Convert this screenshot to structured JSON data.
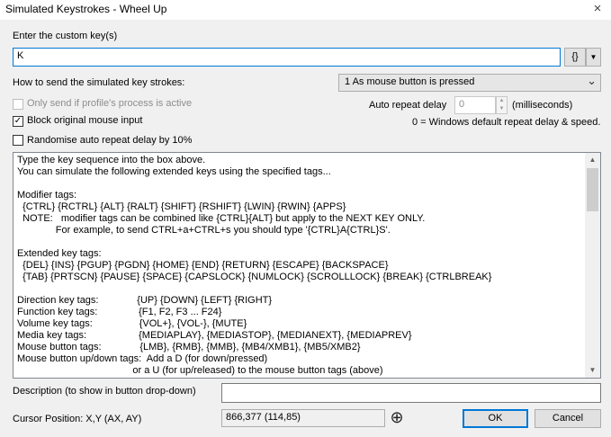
{
  "window": {
    "title": "Simulated Keystrokes - Wheel Up",
    "close_glyph": "×"
  },
  "custom_keys": {
    "label": "Enter the custom key(s)",
    "value": "K",
    "tags_button_label": "{}",
    "tags_dropdown_glyph": "▼"
  },
  "send_mode": {
    "label": "How to send the simulated key strokes:",
    "selected": "1 As mouse button is pressed",
    "arrow_glyph": "⌄"
  },
  "options": {
    "only_send_if_active": {
      "label": "Only send if profile's process is active",
      "checked": false,
      "disabled": true
    },
    "block_original": {
      "label": "Block original mouse input",
      "checked": true
    },
    "randomise_delay": {
      "label": "Randomise auto repeat delay by 10%",
      "checked": false
    }
  },
  "auto_repeat": {
    "label": "Auto repeat delay",
    "value": "0",
    "units": "(milliseconds)",
    "note": "0 = Windows default repeat delay & speed.",
    "up_glyph": "▲",
    "down_glyph": "▼"
  },
  "help_text": [
    "Type the key sequence into the box above.",
    "You can simulate the following extended keys using the specified tags...",
    "",
    "Modifier tags:",
    "  {CTRL} {RCTRL} {ALT} {RALT} {SHIFT} {RSHIFT} {LWIN} {RWIN} {APPS}",
    "  NOTE:   modifier tags can be combined like {CTRL}{ALT} but apply to the NEXT KEY ONLY.",
    "              For example, to send CTRL+a+CTRL+s you should type '{CTRL}A{CTRL}S'.",
    "",
    "Extended key tags:",
    "  {DEL} {INS} {PGUP} {PGDN} {HOME} {END} {RETURN} {ESCAPE} {BACKSPACE}",
    "  {TAB} {PRTSCN} {PAUSE} {SPACE} {CAPSLOCK} {NUMLOCK} {SCROLLLOCK} {BREAK} {CTRLBREAK}",
    "",
    "Direction key tags:              {UP} {DOWN} {LEFT} {RIGHT}",
    "Function key tags:               {F1, F2, F3 ... F24}",
    "Volume key tags:                 {VOL+}, {VOL-}, {MUTE}",
    "Media key tags:                   {MEDIAPLAY}, {MEDIASTOP}, {MEDIANEXT}, {MEDIAPREV}",
    "Mouse button tags:              {LMB}, {RMB}, {MMB}, {MB4/XMB1}, {MB5/XMB2}",
    "Mouse button up/down tags:  Add a D (for down/pressed)",
    "                                          or a U (for up/released) to the mouse button tags (above)"
  ],
  "scrollbar": {
    "up_glyph": "▲",
    "down_glyph": "▼"
  },
  "description": {
    "label": "Description (to show in button drop-down)",
    "value": ""
  },
  "cursor": {
    "label": "Cursor Position: X,Y (AX, AY)",
    "value": "866,377 (114,85)",
    "picker_glyph": "⊕"
  },
  "buttons": {
    "ok": "OK",
    "cancel": "Cancel"
  }
}
